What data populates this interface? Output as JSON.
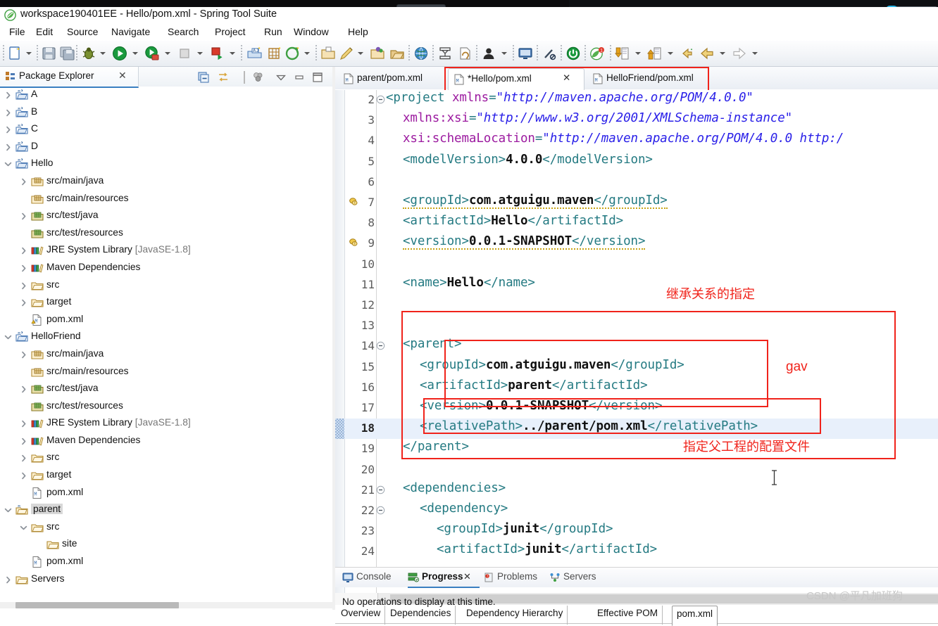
{
  "window": {
    "title": "workspace190401EE - Hello/pom.xml - Spring Tool Suite",
    "icon": "sts-leaf-icon"
  },
  "menu": {
    "items": [
      "File",
      "Edit",
      "Source",
      "Navigate",
      "Search",
      "Project",
      "Run",
      "Window",
      "Help"
    ]
  },
  "toolbar": {
    "icons": [
      "new-wizard-icon",
      "save-icon",
      "save-all-icon",
      "debug-icon",
      "run-icon",
      "run-coverage-icon",
      "terminate-icon",
      "run-server-icon",
      "new-spring-project-icon",
      "new-element-icon",
      "spring-boot-dashboard-icon",
      "open-type-icon",
      "edit-icon",
      "open-resource-icon",
      "open-task-icon",
      "globe-icon",
      "hierarchy-icon",
      "refresh-icon",
      "user-icon",
      "display-icon",
      "disable-icon",
      "power-icon",
      "sts-boot-icon",
      "download-icon",
      "upload-icon",
      "back-icon",
      "prev-annotation-icon",
      "next-annotation-icon"
    ]
  },
  "package_explorer": {
    "tab_label": "Package Explorer",
    "tab_icon": "package-explorer-icon",
    "close_glyph": "✕",
    "toolbar_icons": [
      "collapse-all-icon",
      "link-with-editor-icon",
      "filters-icon",
      "view-menu-icon",
      "minimize-icon",
      "maximize-icon"
    ],
    "tree": [
      {
        "label": "A",
        "icon": "maven-project-icon",
        "indent": 0,
        "twist": "collapsed"
      },
      {
        "label": "B",
        "icon": "maven-project-icon",
        "indent": 0,
        "twist": "collapsed"
      },
      {
        "label": "C",
        "icon": "maven-project-icon",
        "indent": 0,
        "twist": "collapsed"
      },
      {
        "label": "D",
        "icon": "maven-project-icon",
        "indent": 0,
        "twist": "collapsed"
      },
      {
        "label": "Hello",
        "icon": "maven-project-icon",
        "indent": 0,
        "twist": "expanded"
      },
      {
        "label": "src/main/java",
        "icon": "source-folder-icon",
        "indent": 1,
        "twist": "collapsed"
      },
      {
        "label": "src/main/resources",
        "icon": "source-folder-icon",
        "indent": 1,
        "twist": "none"
      },
      {
        "label": "src/test/java",
        "icon": "test-source-folder-icon",
        "indent": 1,
        "twist": "collapsed"
      },
      {
        "label": "src/test/resources",
        "icon": "test-source-folder-icon",
        "indent": 1,
        "twist": "none"
      },
      {
        "label": "JRE System Library",
        "suffix": " [JavaSE-1.8]",
        "icon": "library-icon",
        "indent": 1,
        "twist": "collapsed"
      },
      {
        "label": "Maven Dependencies",
        "icon": "library-icon",
        "indent": 1,
        "twist": "collapsed"
      },
      {
        "label": "src",
        "icon": "folder-icon",
        "indent": 1,
        "twist": "collapsed"
      },
      {
        "label": "target",
        "icon": "folder-icon",
        "indent": 1,
        "twist": "collapsed"
      },
      {
        "label": "pom.xml",
        "icon": "pom-file-warning-icon",
        "indent": 1,
        "twist": "none"
      },
      {
        "label": "HelloFriend",
        "icon": "maven-project-icon",
        "indent": 0,
        "twist": "expanded"
      },
      {
        "label": "src/main/java",
        "icon": "source-folder-icon",
        "indent": 1,
        "twist": "collapsed"
      },
      {
        "label": "src/main/resources",
        "icon": "source-folder-icon",
        "indent": 1,
        "twist": "none"
      },
      {
        "label": "src/test/java",
        "icon": "test-source-folder-icon",
        "indent": 1,
        "twist": "collapsed"
      },
      {
        "label": "src/test/resources",
        "icon": "test-source-folder-icon",
        "indent": 1,
        "twist": "none"
      },
      {
        "label": "JRE System Library",
        "suffix": " [JavaSE-1.8]",
        "icon": "library-icon",
        "indent": 1,
        "twist": "collapsed"
      },
      {
        "label": "Maven Dependencies",
        "icon": "library-icon",
        "indent": 1,
        "twist": "collapsed"
      },
      {
        "label": "src",
        "icon": "folder-icon",
        "indent": 1,
        "twist": "collapsed"
      },
      {
        "label": "target",
        "icon": "folder-icon",
        "indent": 1,
        "twist": "collapsed"
      },
      {
        "label": "pom.xml",
        "icon": "pom-file-icon",
        "indent": 1,
        "twist": "none"
      },
      {
        "label": "parent",
        "icon": "maven-folder-icon",
        "indent": 0,
        "twist": "expanded",
        "selected": true
      },
      {
        "label": "src",
        "icon": "folder-icon",
        "indent": 1,
        "twist": "expanded"
      },
      {
        "label": "site",
        "icon": "folder-icon",
        "indent": 2,
        "twist": "none"
      },
      {
        "label": "pom.xml",
        "icon": "pom-file-icon",
        "indent": 1,
        "twist": "none"
      },
      {
        "label": "Servers",
        "icon": "folder-icon",
        "indent": 0,
        "twist": "collapsed"
      }
    ]
  },
  "editor": {
    "tabs": [
      {
        "label": "parent/pom.xml",
        "icon": "pom-file-icon",
        "active": false,
        "dirty": false,
        "closable": false
      },
      {
        "label": "*Hello/pom.xml",
        "icon": "pom-file-icon",
        "active": true,
        "dirty": true,
        "closable": true,
        "close_glyph": "✕"
      },
      {
        "label": "HelloFriend/pom.xml",
        "icon": "pom-file-icon",
        "active": false,
        "dirty": false,
        "closable": false
      }
    ],
    "lines": [
      {
        "n": "2",
        "fold": "collapse",
        "indent": 0,
        "segments": [
          {
            "t": "tag",
            "v": "<project "
          },
          {
            "t": "atr",
            "v": "xmlns"
          },
          {
            "t": "tag",
            "v": "="
          },
          {
            "t": "str",
            "v": "\"http://maven.apache.org/POM/4.0.0\""
          }
        ]
      },
      {
        "n": "3",
        "fold": "",
        "indent": 1,
        "segments": [
          {
            "t": "atr",
            "v": "xmlns:xsi"
          },
          {
            "t": "tag",
            "v": "="
          },
          {
            "t": "str",
            "v": "\"http://www.w3.org/2001/XMLSchema-instance\""
          }
        ]
      },
      {
        "n": "4",
        "fold": "",
        "indent": 1,
        "segments": [
          {
            "t": "atr",
            "v": "xsi:schemaLocation"
          },
          {
            "t": "tag",
            "v": "="
          },
          {
            "t": "str",
            "v": "\"http://maven.apache.org/POM/4.0.0 http:/"
          }
        ]
      },
      {
        "n": "5",
        "fold": "",
        "indent": 1,
        "segments": [
          {
            "t": "tag",
            "v": "<modelVersion>"
          },
          {
            "t": "val",
            "v": "4.0.0"
          },
          {
            "t": "tag",
            "v": "</modelVersion>"
          }
        ]
      },
      {
        "n": "6",
        "fold": "",
        "indent": 0,
        "segments": []
      },
      {
        "n": "7",
        "fold": "",
        "warn": true,
        "indent": 1,
        "squiggle": true,
        "segments": [
          {
            "t": "tag",
            "v": "<groupId>"
          },
          {
            "t": "val",
            "v": "com.atguigu.maven"
          },
          {
            "t": "tag",
            "v": "</groupId>"
          }
        ]
      },
      {
        "n": "8",
        "fold": "",
        "indent": 1,
        "segments": [
          {
            "t": "tag",
            "v": "<artifactId>"
          },
          {
            "t": "val",
            "v": "Hello"
          },
          {
            "t": "tag",
            "v": "</artifactId>"
          }
        ]
      },
      {
        "n": "9",
        "fold": "",
        "warn": true,
        "indent": 1,
        "squiggle": true,
        "segments": [
          {
            "t": "tag",
            "v": "<version>"
          },
          {
            "t": "val",
            "v": "0.0.1-SNAPSHOT"
          },
          {
            "t": "tag",
            "v": "</version>"
          }
        ]
      },
      {
        "n": "10",
        "fold": "",
        "indent": 0,
        "segments": []
      },
      {
        "n": "11",
        "fold": "",
        "indent": 1,
        "segments": [
          {
            "t": "tag",
            "v": "<name>"
          },
          {
            "t": "val",
            "v": "Hello"
          },
          {
            "t": "tag",
            "v": "</name>"
          }
        ]
      },
      {
        "n": "12",
        "fold": "",
        "indent": 0,
        "segments": []
      },
      {
        "n": "13",
        "fold": "",
        "indent": 0,
        "segments": []
      },
      {
        "n": "14",
        "fold": "collapse",
        "indent": 1,
        "segments": [
          {
            "t": "tag",
            "v": "<parent>"
          }
        ]
      },
      {
        "n": "15",
        "fold": "",
        "indent": 2,
        "segments": [
          {
            "t": "tag",
            "v": "<groupId>"
          },
          {
            "t": "val",
            "v": "com.atguigu.maven"
          },
          {
            "t": "tag",
            "v": "</groupId>"
          }
        ]
      },
      {
        "n": "16",
        "fold": "",
        "indent": 2,
        "segments": [
          {
            "t": "tag",
            "v": "<artifactId>"
          },
          {
            "t": "val",
            "v": "parent"
          },
          {
            "t": "tag",
            "v": "</artifactId>"
          }
        ]
      },
      {
        "n": "17",
        "fold": "",
        "indent": 2,
        "segments": [
          {
            "t": "tag",
            "v": "<version>"
          },
          {
            "t": "val",
            "v": "0.0.1-SNAPSHOT"
          },
          {
            "t": "tag",
            "v": "</version>"
          }
        ]
      },
      {
        "n": "18",
        "fold": "",
        "current": true,
        "indent": 2,
        "segments": [
          {
            "t": "tag",
            "v": "<relativePath>"
          },
          {
            "t": "val",
            "v": "../parent/pom.xml"
          },
          {
            "t": "tag",
            "v": "</relativePath>"
          }
        ]
      },
      {
        "n": "19",
        "fold": "",
        "indent": 1,
        "segments": [
          {
            "t": "tag",
            "v": "</parent>"
          }
        ]
      },
      {
        "n": "20",
        "fold": "",
        "indent": 0,
        "segments": []
      },
      {
        "n": "21",
        "fold": "collapse",
        "indent": 1,
        "segments": [
          {
            "t": "tag",
            "v": "<dependencies>"
          }
        ]
      },
      {
        "n": "22",
        "fold": "collapse",
        "indent": 2,
        "segments": [
          {
            "t": "tag",
            "v": "<dependency>"
          }
        ]
      },
      {
        "n": "23",
        "fold": "",
        "indent": 3,
        "segments": [
          {
            "t": "tag",
            "v": "<groupId>"
          },
          {
            "t": "val",
            "v": "junit"
          },
          {
            "t": "tag",
            "v": "</groupId>"
          }
        ]
      },
      {
        "n": "24",
        "fold": "",
        "indent": 3,
        "segments": [
          {
            "t": "tag",
            "v": "<artifactId>"
          },
          {
            "t": "val",
            "v": "junit"
          },
          {
            "t": "tag",
            "v": "</artifactId>"
          }
        ]
      }
    ],
    "annotations": [
      {
        "name": "tab-highlight-box",
        "type": "box"
      },
      {
        "name": "parent-block-box",
        "type": "box"
      },
      {
        "name": "gav-box",
        "type": "box"
      },
      {
        "name": "relative-path-box",
        "type": "box"
      },
      {
        "name": "inheritance-label",
        "type": "text",
        "text": "继承关系的指定"
      },
      {
        "name": "gav-label",
        "type": "text",
        "text": "gav"
      },
      {
        "name": "relative-path-label",
        "type": "text",
        "text": "指定父工程的配置文件"
      }
    ],
    "cursor_icon": "text-caret-icon"
  },
  "form_tabs": {
    "items": [
      "Overview",
      "Dependencies",
      "Dependency Hierarchy",
      "Effective POM",
      "pom.xml"
    ],
    "active": "pom.xml"
  },
  "view_tabs": {
    "items": [
      {
        "label": "Console",
        "icon": "console-icon",
        "active": false
      },
      {
        "label": "Progress",
        "icon": "progress-icon",
        "active": true,
        "close_glyph": "✕"
      },
      {
        "label": "Problems",
        "icon": "problems-icon",
        "active": false
      },
      {
        "label": "Servers",
        "icon": "servers-icon",
        "active": false
      }
    ],
    "content": "No operations to display at this time."
  },
  "watermark": "CSDN @平凡加班狗",
  "colors": {
    "annotation_red": "#f0231b",
    "tag": "#247a82",
    "attribute": "#9c1ba0",
    "string": "#2a20e8",
    "selection_blue": "#e8f0fb",
    "accent": "#3a7fc1"
  }
}
